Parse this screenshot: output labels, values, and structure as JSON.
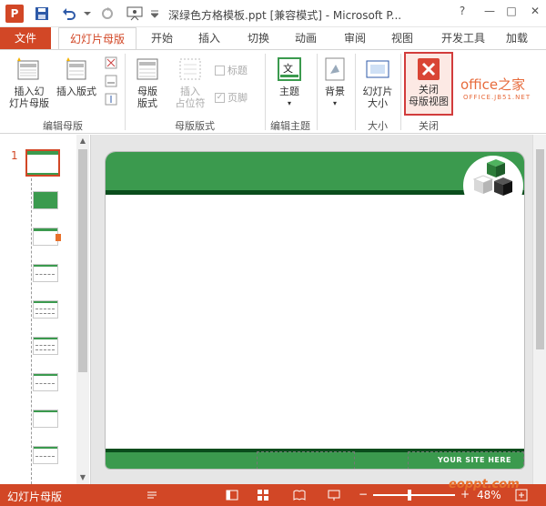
{
  "title_bar": {
    "app_icon_letter": "P",
    "document_title": "深绿色方格模板.ppt [兼容模式] - Microsoft P...",
    "help": "?",
    "minimize": "—",
    "maximize": "□",
    "close": "✕"
  },
  "tabs": {
    "file": "文件",
    "items": [
      "幻灯片母版",
      "开始",
      "插入",
      "切换",
      "动画",
      "审阅",
      "视图",
      "开发工具",
      "加载"
    ]
  },
  "ribbon": {
    "groups": {
      "edit_master": "编辑母版",
      "master_layout": "母版版式",
      "edit_theme": "编辑主题",
      "size": "大小",
      "close": "关闭"
    },
    "buttons": {
      "insert_slide_master": [
        "插入幻",
        "灯片母版"
      ],
      "insert_layout": "插入版式",
      "master_layout": [
        "母版",
        "版式"
      ],
      "insert_placeholder": [
        "插入",
        "占位符"
      ],
      "title_check": "标题",
      "footer_check": "页脚",
      "theme": "主题",
      "background": "背景",
      "slide_size": [
        "幻灯片",
        "大小"
      ],
      "close_master_view": [
        "关闭",
        "母版视图"
      ]
    },
    "watermark": "office之家",
    "watermark_sub": "OFFICE.JB51.NET"
  },
  "thumbnails": {
    "slide_number": "1"
  },
  "slide": {
    "site_text": "YOUR SITE HERE"
  },
  "status_bar": {
    "mode": "幻灯片母版",
    "zoom": "48%",
    "brand": "eoppt.com"
  },
  "colors": {
    "accent": "#d24726",
    "slide_green": "#3b9a4e",
    "slide_dark_green": "#0a4d1c"
  }
}
